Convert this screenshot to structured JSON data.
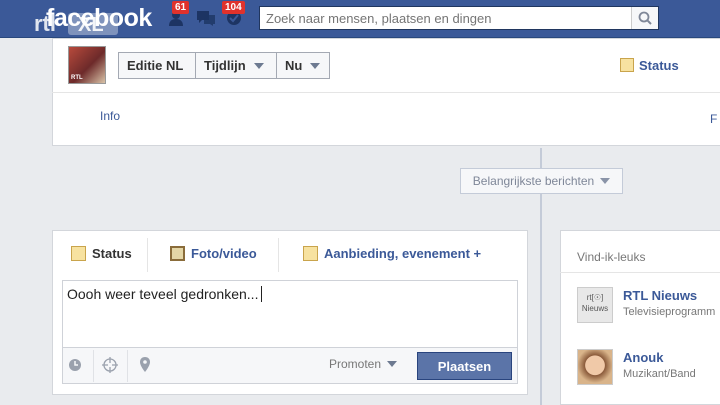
{
  "header": {
    "logo_text": "facebook",
    "overlay_logo": "rtl XL",
    "friend_requests_count": "61",
    "messages_count": "",
    "notifications_count": "104",
    "search_placeholder": "Zoek naar mensen, plaatsen en dingen"
  },
  "profile_bar": {
    "avatar_text": "RTL",
    "edition_label": "Editie NL",
    "timeline_label": "Tijdlijn",
    "now_label": "Nu",
    "status_link": "Status",
    "info_link": "Info",
    "edge_link": "F"
  },
  "timeline": {
    "sort_label": "Belangrijkste berichten"
  },
  "composer": {
    "tabs": [
      {
        "label": "Status",
        "icon": "status-icon"
      },
      {
        "label": "Foto/video",
        "icon": "photo-icon"
      },
      {
        "label": "Aanbieding, evenement +",
        "icon": "offer-icon"
      }
    ],
    "text": "Oooh weer teveel gedronken...",
    "promote_label": "Promoten",
    "post_label": "Plaatsen"
  },
  "likes": {
    "title": "Vind-ik-leuks",
    "items": [
      {
        "name": "RTL Nieuws",
        "category": "Televisieprogramm",
        "pic_text": "rt[☉]\nNieuws"
      },
      {
        "name": "Anouk",
        "category": "Muzikant/Band",
        "pic_text": ""
      }
    ]
  },
  "colors": {
    "brand_blue": "#3b5998",
    "post_button": "#5b74a8",
    "badge_red": "#e0322c"
  }
}
